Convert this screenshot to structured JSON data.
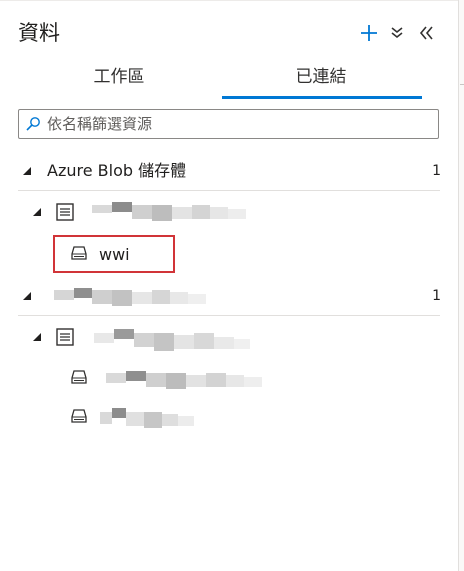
{
  "panel": {
    "title": "資料",
    "add_icon": "plus-icon",
    "collapse_icon": "double-chevron-down-icon",
    "hide_icon": "double-chevron-left-icon"
  },
  "tabs": [
    {
      "label": "工作區",
      "selected": false
    },
    {
      "label": "已連結",
      "selected": true
    }
  ],
  "accent_color": "#0078d4",
  "highlight_color": "#d13438",
  "search": {
    "placeholder": "依名稱篩選資源",
    "value": ""
  },
  "tree": {
    "group1": {
      "label": "Azure Blob 儲存體",
      "count": "1"
    },
    "container": {
      "label": "wwi"
    },
    "group2": {
      "count": "1"
    }
  }
}
